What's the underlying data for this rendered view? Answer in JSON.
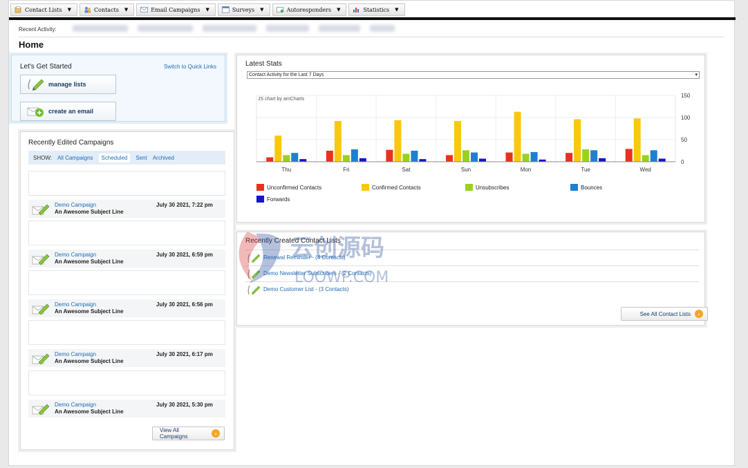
{
  "nav": [
    {
      "label": "Contact Lists",
      "icon": "contact-lists-icon"
    },
    {
      "label": "Contacts",
      "icon": "contacts-icon"
    },
    {
      "label": "Email Campaigns",
      "icon": "email-icon"
    },
    {
      "label": "Surveys",
      "icon": "survey-icon"
    },
    {
      "label": "Autoresponders",
      "icon": "autoresponder-icon"
    },
    {
      "label": "Statistics",
      "icon": "statistics-icon"
    }
  ],
  "recent_activity_label": "Recent Activity:",
  "page_title": "Home",
  "get_started": {
    "title": "Let's Get Started",
    "switch_link": "Switch to Quick Links",
    "manage_lists": "manage lists",
    "create_email": "create an email"
  },
  "recent_campaigns": {
    "title": "Recently Edited Campaigns",
    "show_label": "SHOW:",
    "filters": [
      "All Campaigns",
      "Scheduled",
      "Sent",
      "Archived"
    ],
    "active_filter": "Scheduled",
    "items": [
      {
        "name": "Demo Campaign",
        "subject": "An Awesome Subject Line",
        "date": "July 30 2021, 7:22 pm"
      },
      {
        "name": "Demo Campaign",
        "subject": "An Awesome Subject Line",
        "date": "July 30 2021, 6:59 pm"
      },
      {
        "name": "Demo Campaign",
        "subject": "An Awesome Subject Line",
        "date": "July 30 2021, 6:56 pm"
      },
      {
        "name": "Demo Campaign",
        "subject": "An Awesome Subject Line",
        "date": "July 30 2021, 6:17 pm"
      },
      {
        "name": "Demo Campaign",
        "subject": "An Awesome Subject Line",
        "date": "July 30 2021, 5:30 pm"
      }
    ],
    "view_all": "View All Campaigns"
  },
  "stats": {
    "title": "Latest Stats",
    "select_value": "Contact Activity for the Last 7 Days",
    "chart_credit": "JS chart by amCharts"
  },
  "chart_data": {
    "type": "bar",
    "categories": [
      "Thu",
      "Fri",
      "Sat",
      "Sun",
      "Mon",
      "Tue",
      "Wed"
    ],
    "ylim": [
      0,
      150
    ],
    "yticks": [
      0,
      50,
      100,
      150
    ],
    "legend_position": "bottom",
    "series": [
      {
        "name": "Unconfirmed Contacts",
        "color": "#e8321e",
        "values": [
          10,
          25,
          27,
          15,
          21,
          20,
          29
        ]
      },
      {
        "name": "Confirmed Contacts",
        "color": "#f9c80e",
        "values": [
          59,
          92,
          94,
          92,
          113,
          96,
          98
        ]
      },
      {
        "name": "Unsubscribes",
        "color": "#9bd11e",
        "values": [
          15,
          15,
          18,
          26,
          18,
          28,
          15
        ]
      },
      {
        "name": "Bounces",
        "color": "#1f7fcf",
        "values": [
          20,
          28,
          25,
          21,
          22,
          26,
          26
        ]
      },
      {
        "name": "Forwards",
        "color": "#1515c9",
        "values": [
          6,
          8,
          6,
          7,
          5,
          8,
          7
        ]
      }
    ]
  },
  "contact_lists": {
    "title": "Recently Created Contact Lists",
    "items": [
      "Renewal Reminder - (4 Contacts)",
      "Demo Newsletter Subscribers - (2 Contacts)",
      "Demo Customer List - (3 Contacts)"
    ],
    "see_all": "See All Contact Lists"
  },
  "watermark": {
    "line1": "云创源码",
    "line2": "LOOWP.COM"
  }
}
